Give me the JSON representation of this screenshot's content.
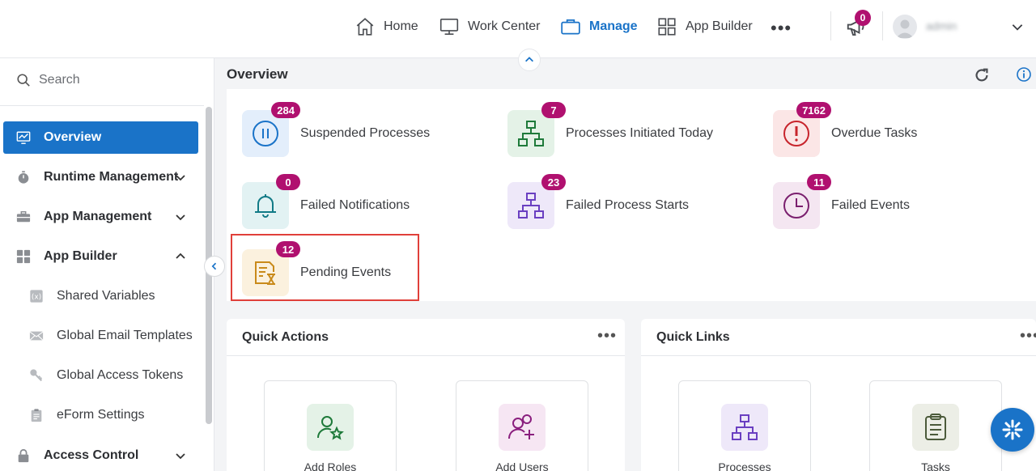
{
  "topnav": {
    "items": [
      {
        "label": "Home",
        "icon": "home-icon"
      },
      {
        "label": "Work Center",
        "icon": "monitor-icon"
      },
      {
        "label": "Manage",
        "icon": "briefcase-icon",
        "active": true
      },
      {
        "label": "App Builder",
        "icon": "grid-icon"
      }
    ],
    "more": "•••",
    "notifications_count": "0",
    "username": "admin"
  },
  "sidebar": {
    "search_label": "Search",
    "items": [
      {
        "label": "Overview",
        "icon": "monitor-chart-icon",
        "active": true
      },
      {
        "label": "Runtime Management",
        "icon": "stopwatch-icon",
        "chevron": "down"
      },
      {
        "label": "App Management",
        "icon": "toolbox-icon",
        "chevron": "down"
      },
      {
        "label": "App Builder",
        "icon": "grid-icon",
        "chevron": "up"
      },
      {
        "label": "Shared Variables",
        "icon": "variable-icon"
      },
      {
        "label": "Global Email Templates",
        "icon": "envelope-icon"
      },
      {
        "label": "Global Access Tokens",
        "icon": "key-icon"
      },
      {
        "label": "eForm Settings",
        "icon": "clipboard-icon"
      },
      {
        "label": "Access Control",
        "icon": "lock-icon",
        "chevron": "down"
      }
    ]
  },
  "overview": {
    "title": "Overview",
    "stats": [
      {
        "label": "Suspended Processes",
        "count": "284",
        "icon": "pause-icon",
        "color": "#1a73c8",
        "bg": "#e3eefb"
      },
      {
        "label": "Processes Initiated Today",
        "count": "7",
        "icon": "hierarchy-icon",
        "color": "#1e7a3a",
        "bg": "#e4f2e7"
      },
      {
        "label": "Overdue Tasks",
        "count": "7162",
        "icon": "alert-icon",
        "color": "#c7242c",
        "bg": "#fbe6e6"
      },
      {
        "label": "Failed Notifications",
        "count": "0",
        "icon": "bell-icon",
        "color": "#117a86",
        "bg": "#e2f2f3"
      },
      {
        "label": "Failed Process Starts",
        "count": "23",
        "icon": "hierarchy-icon",
        "color": "#6a3fc1",
        "bg": "#eee8f9"
      },
      {
        "label": "Failed Events",
        "count": "11",
        "icon": "clock-icon",
        "color": "#7a1f6e",
        "bg": "#f4e6f1"
      },
      {
        "label": "Pending Events",
        "count": "12",
        "icon": "document-hourglass-icon",
        "color": "#c98a1a",
        "bg": "#fbf1de"
      }
    ]
  },
  "quick_actions": {
    "title": "Quick Actions",
    "more": "•••",
    "items": [
      {
        "label": "Add Roles",
        "icon": "user-star-icon",
        "color": "#1e7a3a",
        "bg": "#e4f2e7"
      },
      {
        "label": "Add Users",
        "icon": "user-add-icon",
        "color": "#8a1f7e",
        "bg": "#f6e6f3"
      }
    ]
  },
  "quick_links": {
    "title": "Quick Links",
    "more": "•••",
    "items": [
      {
        "label": "Processes",
        "icon": "hierarchy-icon",
        "color": "#6a3fc1",
        "bg": "#eee8f9"
      },
      {
        "label": "Tasks",
        "icon": "clipboard-list-icon",
        "color": "#4b5a3a",
        "bg": "#eceee6"
      }
    ]
  }
}
